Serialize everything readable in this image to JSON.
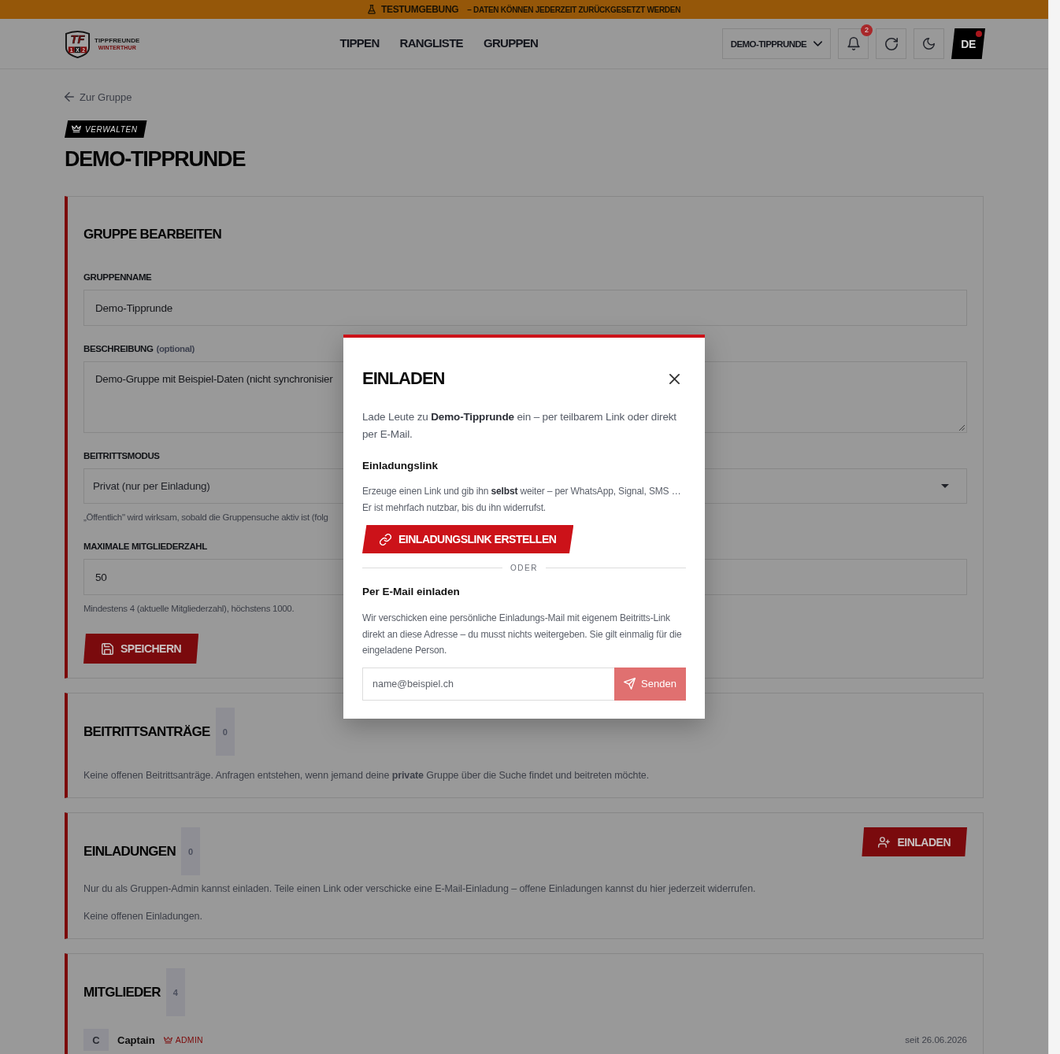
{
  "env_banner": {
    "title": "TESTUMGEBUNG",
    "message": "– DATEN KÖNNEN JEDERZEIT ZURÜCKGESETZT WERDEN"
  },
  "header": {
    "logo": {
      "monogram": "TF",
      "marks": [
        "1",
        "X",
        "2"
      ],
      "wordmark": "TIPPFREUNDE",
      "tagline": "WINTERTHUR"
    },
    "nav": [
      {
        "label": "TIPPEN",
        "selected": false
      },
      {
        "label": "RANGLISTE",
        "selected": false
      },
      {
        "label": "GRUPPEN",
        "selected": false
      }
    ],
    "group_switcher": {
      "label": "DEMO-TIPPRUNDE"
    },
    "notifications": {
      "count": "2"
    },
    "language": {
      "label": "DE",
      "indicator": true
    }
  },
  "back_link": "Zur Gruppe",
  "page_badge": "VERWALTEN",
  "page_title": "DEMO-TIPPRUNDE",
  "edit_card": {
    "title": "GRUPPE BEARBEITEN",
    "fields": [
      {
        "kind": "input",
        "label": "GRUPPENNAME",
        "value": "Demo-Tipprunde"
      },
      {
        "kind": "textarea",
        "label": "BESCHREIBUNG",
        "label_note": "(optional)",
        "value": "Demo-Gruppe mit Beispiel-Daten (nicht synchronisier"
      },
      {
        "kind": "select",
        "label": "BEITRITTSMODUS",
        "value": "Privat (nur per Einladung)",
        "hint": "„Öffentlich\" wird wirksam, sobald die Gruppensuche aktiv ist (folg"
      },
      {
        "kind": "input",
        "label": "MAXIMALE MITGLIEDERZAHL",
        "value": "50",
        "hint": "Mindestens 4 (aktuelle Mitgliederzahl), höchstens 1000."
      }
    ],
    "save_button": "SPEICHERN"
  },
  "requests_card": {
    "title": "BEITRITTSANTRÄGE",
    "count": "0",
    "text": "Keine offenen Beitrittsanträge. Anfragen entstehen, wenn jemand deine **private** Gruppe über die Suche findet und beitreten möchte."
  },
  "invites_card": {
    "title": "EINLADUNGEN",
    "count": "0",
    "button": "EINLADEN",
    "text": "Nur du als Gruppen-Admin kannst einladen. Teile einen Link oder verschicke eine E-Mail-Einladung – offene Einladungen kannst du hier jederzeit widerrufen.",
    "empty_text": "Keine offenen Einladungen."
  },
  "members_card": {
    "title": "MITGLIEDER",
    "count": "4",
    "members": [
      {
        "initial": "C",
        "name": "Captain",
        "role": "ADMIN",
        "since": "seit 26.06.2026"
      }
    ]
  },
  "modal": {
    "title": "EINLADEN",
    "intro": "Lade Leute zu **Demo-Tipprunde** ein – per teilbarem Link oder direkt per E-Mail.",
    "link_section": {
      "heading": "Einladungslink",
      "text": "Erzeuge einen Link und gib ihn **selbst** weiter – per WhatsApp, Signal, SMS … Er ist mehrfach nutzbar, bis du ihn widerrufst.",
      "button": "EINLADUNGSLINK ERSTELLEN"
    },
    "divider": "ODER",
    "email_section": {
      "heading": "Per E-Mail einladen",
      "text": "Wir verschicken eine persönliche Einladungs-Mail mit eigenem Beitritts-Link direkt an diese Adresse – du musst nichts weitergeben. Sie gilt einmalig für die eingeladene Person.",
      "placeholder": "name@beispiel.ch",
      "send_button": {
        "label": "Senden",
        "disabled": true
      }
    }
  }
}
